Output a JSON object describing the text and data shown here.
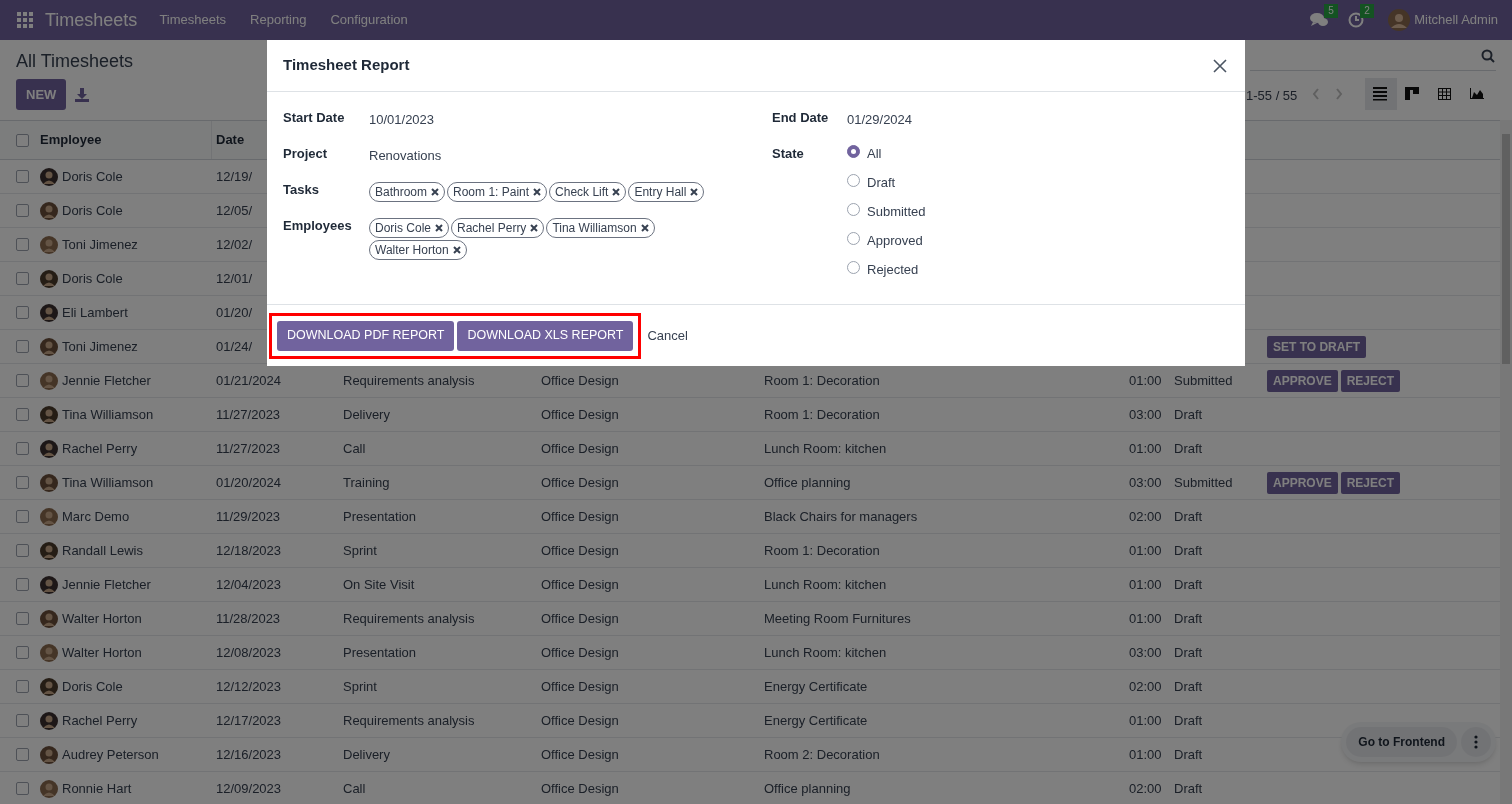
{
  "navbar": {
    "app_name": "Timesheets",
    "menus": [
      "Timesheets",
      "Reporting",
      "Configuration"
    ],
    "messages_badge": "5",
    "activities_badge": "2",
    "user": "Mitchell Admin"
  },
  "control_panel": {
    "title": "All Timesheets",
    "new_button": "NEW",
    "pager": "1-55 / 55",
    "views": [
      {
        "kind": "list",
        "selected": true
      },
      {
        "kind": "kanban",
        "selected": false
      },
      {
        "kind": "pivot",
        "selected": false
      },
      {
        "kind": "graph",
        "selected": false
      }
    ]
  },
  "table": {
    "select_all": false,
    "columns": [
      "Employee",
      "Date"
    ],
    "rows": [
      {
        "checked": false,
        "employee": "Doris Cole",
        "date": "12/19/"
      },
      {
        "checked": false,
        "employee": "Doris Cole",
        "date": "12/05/"
      },
      {
        "checked": false,
        "employee": "Toni Jimenez",
        "date": "12/02/"
      },
      {
        "checked": false,
        "employee": "Doris Cole",
        "date": "12/01/"
      },
      {
        "checked": false,
        "employee": "Eli Lambert",
        "date": "01/20/"
      },
      {
        "checked": false,
        "employee": "Toni Jimenez",
        "date": "01/24/",
        "actions": [
          "SET TO DRAFT"
        ]
      },
      {
        "checked": false,
        "employee": "Jennie Fletcher",
        "date": "01/21/2024",
        "description": "Requirements analysis",
        "project": "Office Design",
        "task": "Room 1: Decoration",
        "hours": "01:00",
        "status": "Submitted",
        "actions": [
          "APPROVE",
          "REJECT"
        ]
      },
      {
        "checked": false,
        "employee": "Tina Williamson",
        "date": "11/27/2023",
        "description": "Delivery",
        "project": "Office Design",
        "task": "Room 1: Decoration",
        "hours": "03:00",
        "status": "Draft"
      },
      {
        "checked": false,
        "employee": "Rachel Perry",
        "date": "11/27/2023",
        "description": "Call",
        "project": "Office Design",
        "task": "Lunch Room: kitchen",
        "hours": "01:00",
        "status": "Draft"
      },
      {
        "checked": false,
        "employee": "Tina Williamson",
        "date": "01/20/2024",
        "description": "Training",
        "project": "Office Design",
        "task": "Office planning",
        "hours": "03:00",
        "status": "Submitted",
        "actions": [
          "APPROVE",
          "REJECT"
        ]
      },
      {
        "checked": false,
        "employee": "Marc Demo",
        "date": "11/29/2023",
        "description": "Presentation",
        "project": "Office Design",
        "task": "Black Chairs for managers",
        "hours": "02:00",
        "status": "Draft"
      },
      {
        "checked": false,
        "employee": "Randall Lewis",
        "date": "12/18/2023",
        "description": "Sprint",
        "project": "Office Design",
        "task": "Room 1: Decoration",
        "hours": "01:00",
        "status": "Draft"
      },
      {
        "checked": false,
        "employee": "Jennie Fletcher",
        "date": "12/04/2023",
        "description": "On Site Visit",
        "project": "Office Design",
        "task": "Lunch Room: kitchen",
        "hours": "01:00",
        "status": "Draft"
      },
      {
        "checked": false,
        "employee": "Walter Horton",
        "date": "11/28/2023",
        "description": "Requirements analysis",
        "project": "Office Design",
        "task": "Meeting Room Furnitures",
        "hours": "01:00",
        "status": "Draft"
      },
      {
        "checked": false,
        "employee": "Walter Horton",
        "date": "12/08/2023",
        "description": "Presentation",
        "project": "Office Design",
        "task": "Lunch Room: kitchen",
        "hours": "03:00",
        "status": "Draft"
      },
      {
        "checked": false,
        "employee": "Doris Cole",
        "date": "12/12/2023",
        "description": "Sprint",
        "project": "Office Design",
        "task": "Energy Certificate",
        "hours": "02:00",
        "status": "Draft"
      },
      {
        "checked": false,
        "employee": "Rachel Perry",
        "date": "12/17/2023",
        "description": "Requirements analysis",
        "project": "Office Design",
        "task": "Energy Certificate",
        "hours": "01:00",
        "status": "Draft"
      },
      {
        "checked": false,
        "employee": "Audrey Peterson",
        "date": "12/16/2023",
        "description": "Delivery",
        "project": "Office Design",
        "task": "Room 2: Decoration",
        "hours": "01:00",
        "status": "Draft"
      },
      {
        "checked": false,
        "employee": "Ronnie Hart",
        "date": "12/09/2023",
        "description": "Call",
        "project": "Office Design",
        "task": "Office planning",
        "hours": "02:00",
        "status": "Draft"
      }
    ]
  },
  "floating": {
    "label": "Go to Frontend"
  },
  "dialog": {
    "title": "Timesheet Report",
    "left_fields": [
      {
        "label": "Start Date",
        "value": "10/01/2023"
      },
      {
        "label": "Project",
        "value": "Renovations"
      },
      {
        "label": "Tasks",
        "tags": [
          "Bathroom",
          "Room 1: Paint",
          "Check Lift",
          "Entry Hall"
        ]
      },
      {
        "label": "Employees",
        "tags": [
          "Doris Cole",
          "Rachel Perry",
          "Tina Williamson",
          "Walter Horton"
        ]
      }
    ],
    "right_fields": [
      {
        "label": "End Date",
        "value": "01/29/2024"
      },
      {
        "label": "State",
        "options": [
          {
            "label": "All",
            "selected": true
          },
          {
            "label": "Draft",
            "selected": false
          },
          {
            "label": "Submitted",
            "selected": false
          },
          {
            "label": "Approved",
            "selected": false
          },
          {
            "label": "Rejected",
            "selected": false
          }
        ]
      }
    ],
    "buttons": [
      "DOWNLOAD PDF REPORT",
      "DOWNLOAD XLS REPORT"
    ],
    "cancel": "Cancel"
  }
}
